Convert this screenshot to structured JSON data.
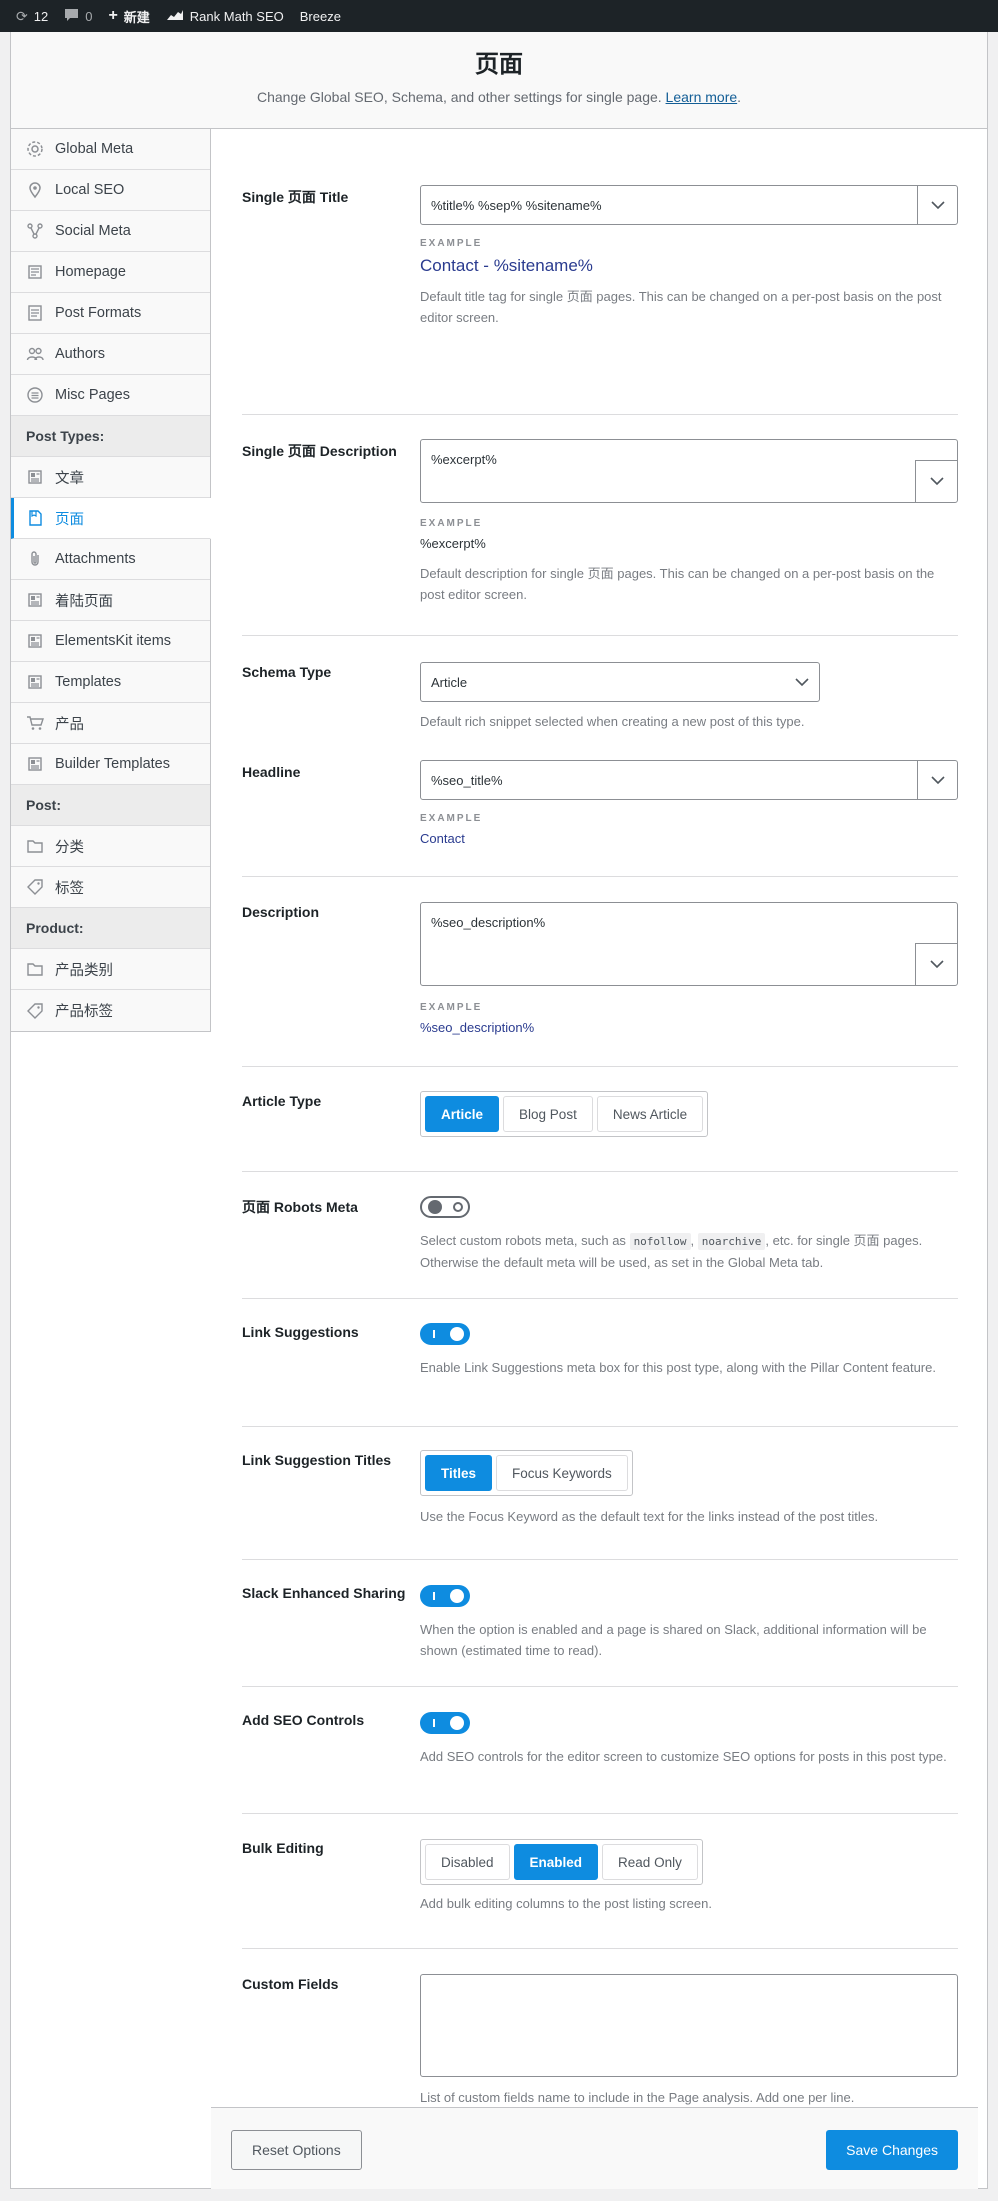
{
  "adminbar": {
    "updates_count": "12",
    "comments_count": "0",
    "new_label": "新建",
    "rankmath_label": "Rank Math SEO",
    "breeze_label": "Breeze"
  },
  "header": {
    "title": "页面",
    "description": "Change Global SEO, Schema, and other settings for single page.",
    "learn_more": "Learn more",
    "period": "."
  },
  "sidebar": {
    "items": [
      {
        "label": "Global Meta",
        "icon": "gear-icon"
      },
      {
        "label": "Local SEO",
        "icon": "map-pin-icon"
      },
      {
        "label": "Social Meta",
        "icon": "share-icon"
      },
      {
        "label": "Homepage",
        "icon": "home-icon"
      },
      {
        "label": "Post Formats",
        "icon": "post-format-icon"
      },
      {
        "label": "Authors",
        "icon": "users-icon"
      },
      {
        "label": "Misc Pages",
        "icon": "list-icon"
      }
    ],
    "group_post_types": "Post Types:",
    "post_types": [
      {
        "label": "文章",
        "icon": "post-icon"
      },
      {
        "label": "页面",
        "icon": "page-icon"
      },
      {
        "label": "Attachments",
        "icon": "paperclip-icon"
      },
      {
        "label": "着陆页面",
        "icon": "post-icon"
      },
      {
        "label": "ElementsKit items",
        "icon": "post-icon"
      },
      {
        "label": "Templates",
        "icon": "post-icon"
      },
      {
        "label": "产品",
        "icon": "cart-icon"
      },
      {
        "label": "Builder Templates",
        "icon": "post-icon"
      }
    ],
    "group_post": "Post:",
    "post": [
      {
        "label": "分类",
        "icon": "folder-icon"
      },
      {
        "label": "标签",
        "icon": "tag-icon"
      }
    ],
    "group_product": "Product:",
    "product": [
      {
        "label": "产品类别",
        "icon": "folder-icon"
      },
      {
        "label": "产品标签",
        "icon": "tag-icon"
      }
    ]
  },
  "fields": {
    "title": {
      "label": "Single 页面 Title",
      "value": "%title% %sep% %sitename%",
      "example_label": "EXAMPLE",
      "example": "Contact - %sitename%",
      "desc": "Default title tag for single 页面 pages. This can be changed on a per-post basis on the post editor screen."
    },
    "description": {
      "label": "Single 页面 Description",
      "value": "%excerpt%",
      "example_label": "EXAMPLE",
      "example": "%excerpt%",
      "desc": "Default description for single 页面 pages. This can be changed on a per-post basis on the post editor screen."
    },
    "schema": {
      "label": "Schema Type",
      "value": "Article",
      "desc": "Default rich snippet selected when creating a new post of this type."
    },
    "headline": {
      "label": "Headline",
      "value": "%seo_title%",
      "example_label": "EXAMPLE",
      "example": "Contact"
    },
    "schema_desc": {
      "label": "Description",
      "value": "%seo_description%",
      "example_label": "EXAMPLE",
      "example": "%seo_description%"
    },
    "article_type": {
      "label": "Article Type",
      "options": [
        "Article",
        "Blog Post",
        "News Article"
      ],
      "selected": "Article"
    },
    "robots": {
      "label": "页面 Robots Meta",
      "enabled": false,
      "desc_pre": "Select custom robots meta, such as",
      "code1": "nofollow",
      "comma": ",",
      "code2": "noarchive",
      "desc_post": ", etc. for single 页面 pages. Otherwise the default meta will be used, as set in the Global Meta tab."
    },
    "link_suggestions": {
      "label": "Link Suggestions",
      "enabled": true,
      "desc": "Enable Link Suggestions meta box for this post type, along with the Pillar Content feature."
    },
    "link_suggestion_titles": {
      "label": "Link Suggestion Titles",
      "options": [
        "Titles",
        "Focus Keywords"
      ],
      "selected": "Titles",
      "desc": "Use the Focus Keyword as the default text for the links instead of the post titles."
    },
    "slack": {
      "label": "Slack Enhanced Sharing",
      "enabled": true,
      "desc": "When the option is enabled and a page is shared on Slack, additional information will be shown (estimated time to read)."
    },
    "seo_controls": {
      "label": "Add SEO Controls",
      "enabled": true,
      "desc": "Add SEO controls for the editor screen to customize SEO options for posts in this post type."
    },
    "bulk_editing": {
      "label": "Bulk Editing",
      "options": [
        "Disabled",
        "Enabled",
        "Read Only"
      ],
      "selected": "Enabled",
      "desc": "Add bulk editing columns to the post listing screen."
    },
    "custom_fields": {
      "label": "Custom Fields",
      "value": "",
      "desc": "List of custom fields name to include in the Page analysis. Add one per line."
    }
  },
  "footer": {
    "reset_label": "Reset Options",
    "save_label": "Save Changes"
  },
  "colors": {
    "accent": "#0e8ce0",
    "adminbar": "#1d2327",
    "example_link": "#2a3b8f"
  }
}
